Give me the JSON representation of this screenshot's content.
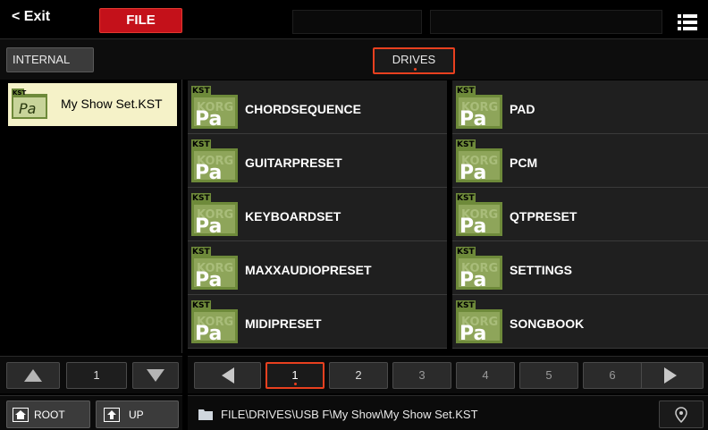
{
  "header": {
    "exit_label": "< Exit",
    "active_tab": "FILE",
    "field1": "",
    "field2": ""
  },
  "sources": {
    "internal_label": "INTERNAL",
    "drives_label": "DRIVES"
  },
  "left_list": {
    "selected_item": "My Show Set.KST",
    "page_number": "1"
  },
  "icon_badge": "KST",
  "icon_text": "Pa",
  "icon_watermark": "KORG",
  "grid": {
    "items": [
      {
        "label": "CHORDSEQUENCE"
      },
      {
        "label": "PAD"
      },
      {
        "label": "GUITARPRESET"
      },
      {
        "label": "PCM"
      },
      {
        "label": "KEYBOARDSET"
      },
      {
        "label": "QTPRESET"
      },
      {
        "label": "MAXXAUDIOPRESET"
      },
      {
        "label": "SETTINGS"
      },
      {
        "label": "MIDIPRESET"
      },
      {
        "label": "SONGBOOK"
      }
    ]
  },
  "pages": [
    "1",
    "2",
    "3",
    "4",
    "5",
    "6"
  ],
  "current_page": "1",
  "bottom": {
    "root_label": "ROOT",
    "up_label": "UP",
    "path": "FILE\\DRIVES\\USB F\\My Show\\My Show Set.KST"
  },
  "colors": {
    "accent": "#e8401f",
    "file_tab": "#c4111a",
    "selection": "#f5f2c8",
    "icon_green": "#6e8a3a"
  }
}
